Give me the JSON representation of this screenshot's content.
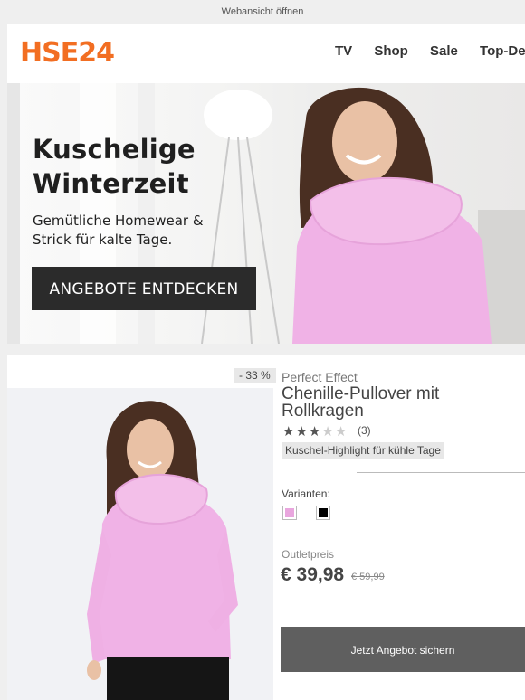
{
  "topbar": {
    "webview_link": "Webansicht öffnen"
  },
  "header": {
    "logo_text": "HSE24",
    "nav": [
      "TV",
      "Shop",
      "Sale",
      "Top-Deals"
    ]
  },
  "hero": {
    "title_line1": "Kuschelige",
    "title_line2": "Winterzeit",
    "subtitle_line1": "Gemütliche Homewear &",
    "subtitle_line2": "Strick für kalte Tage.",
    "cta": "ANGEBOTE ENTDECKEN"
  },
  "product": {
    "discount_badge": "- 33 %",
    "brand": "Perfect Effect",
    "title": "Chenille-Pullover mit Rollkragen",
    "rating": 3,
    "rating_max": 5,
    "review_count": "(3)",
    "highlight": "Kuschel-Highlight für kühle Tage",
    "variants_label": "Varianten:",
    "variants": [
      {
        "color": "#e9a6de"
      },
      {
        "color": "#000000"
      }
    ],
    "price_label": "Outletpreis",
    "price": "€ 39,98",
    "old_price": "€ 59,99",
    "cta": "Jetzt Angebot sichern"
  },
  "colors": {
    "brand_orange": "#f26e22",
    "sweater_pink": "#f0b2e6",
    "button_dark": "#2b2b2b",
    "button_grey": "#5f5f5f"
  }
}
